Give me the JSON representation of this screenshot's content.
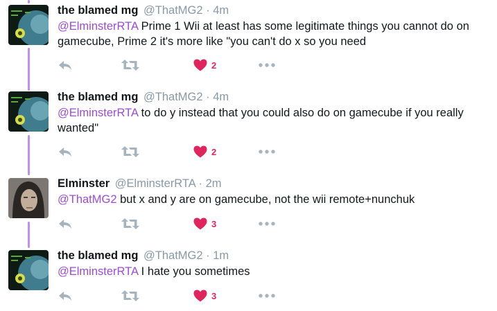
{
  "colors": {
    "thread_line": "#c38df0",
    "mention": "#9d4bd8",
    "like": "#e0245e",
    "muted": "#8899a6"
  },
  "tweets": [
    {
      "name": "the blamed mg",
      "handle": "@ThatMG2",
      "separator": "·",
      "time": "4m",
      "mention": "@ElminsterRTA",
      "text": " Prime 1 Wii at least has some legitimate things you cannot do on gamecube, Prime 2 it's more like \"you can't do x so you need",
      "likes": "2",
      "avatar": "samus-avatar"
    },
    {
      "name": "the blamed mg",
      "handle": "@ThatMG2",
      "separator": "·",
      "time": "4m",
      "mention": "@ElminsterRTA",
      "text": " to do y instead that you could also do on gamecube if you really wanted\"",
      "likes": "2",
      "avatar": "samus-avatar"
    },
    {
      "name": "Elminster",
      "handle": "@ElminsterRTA",
      "separator": "·",
      "time": "2m",
      "mention": "@ThatMG2",
      "text": " but x and y are on gamecube, not the wii remote+nunchuk",
      "likes": "3",
      "avatar": "person-avatar"
    },
    {
      "name": "the blamed mg",
      "handle": "@ThatMG2",
      "separator": "·",
      "time": "1m",
      "mention": "@ElminsterRTA",
      "text": " I hate you sometimes",
      "likes": "3",
      "avatar": "samus-avatar"
    }
  ]
}
